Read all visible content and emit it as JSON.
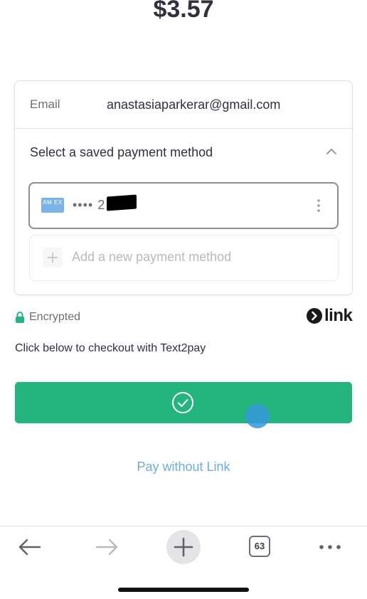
{
  "checkout": {
    "amount": "$3.57"
  },
  "email_row": {
    "label": "Email",
    "value": "anastasiaparkerar@gmail.com"
  },
  "payment_section": {
    "title": "Select a saved payment method",
    "saved_card": {
      "brand_icon": "amex-card-icon",
      "brand_text": "AM EX",
      "masked_number": "•••• 2"
    },
    "add_method_label": "Add a new payment method"
  },
  "security": {
    "encrypted_label": "Encrypted",
    "lock_color": "#24b47e",
    "brand_logo_text": "link"
  },
  "checkout_note": "Click below to checkout with Text2pay",
  "pay_button": {
    "icon": "checkmark-circle-icon",
    "color": "#24b47e"
  },
  "pay_without_link_label": "Pay without Link",
  "browser_toolbar": {
    "back_icon": "arrow-left-icon",
    "forward_icon": "arrow-right-icon",
    "new_tab_icon": "plus-icon",
    "tab_count": "63",
    "more_icon": "ellipsis-icon"
  }
}
